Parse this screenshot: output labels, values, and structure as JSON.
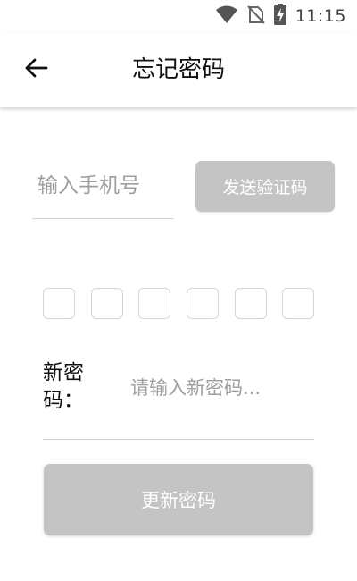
{
  "status_bar": {
    "time": "11:15",
    "icons": [
      "wifi-icon",
      "no-sim-icon",
      "battery-charging-icon"
    ]
  },
  "app_bar": {
    "title": "忘记密码",
    "back_icon": "arrow-left-icon"
  },
  "phone": {
    "placeholder": "输入手机号",
    "value": ""
  },
  "send_code_button": {
    "label": "发送验证码"
  },
  "verification_code": {
    "length": 6,
    "digits": [
      "",
      "",
      "",
      "",
      "",
      ""
    ]
  },
  "new_password": {
    "label": "新密码：",
    "placeholder": "请输入新密码...",
    "value": ""
  },
  "update_button": {
    "label": "更新密码"
  },
  "colors": {
    "button_disabled": "#c4c4c4",
    "divider": "#cfcfcf",
    "placeholder": "#9e9e9e",
    "title": "#111111"
  }
}
